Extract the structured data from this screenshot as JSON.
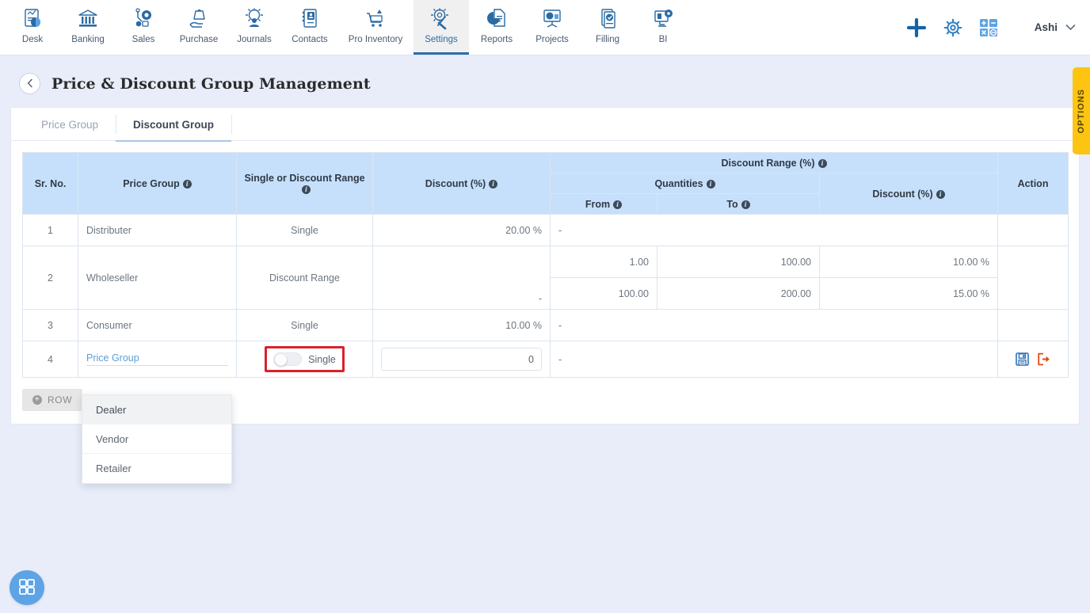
{
  "nav": {
    "items": [
      {
        "label": "Desk",
        "icon": "desk-chart-icon",
        "active": false
      },
      {
        "label": "Banking",
        "icon": "bank-icon",
        "active": false
      },
      {
        "label": "Sales",
        "icon": "sales-icon",
        "active": false
      },
      {
        "label": "Purchase",
        "icon": "purchase-hand-bag-icon",
        "active": false
      },
      {
        "label": "Journals",
        "icon": "journals-gear-people-icon",
        "active": false
      },
      {
        "label": "Contacts",
        "icon": "contacts-card-icon",
        "active": false
      },
      {
        "label": "Pro Inventory",
        "icon": "inventory-cart-icon",
        "active": false
      },
      {
        "label": "Settings",
        "icon": "settings-gear-wrench-icon",
        "active": true
      },
      {
        "label": "Reports",
        "icon": "reports-pie-doc-icon",
        "active": false
      },
      {
        "label": "Projects",
        "icon": "projects-presentation-icon",
        "active": false
      },
      {
        "label": "Filling",
        "icon": "filling-check-doc-icon",
        "active": false
      },
      {
        "label": "BI",
        "icon": "bi-monitor-gear-icon",
        "active": false
      }
    ],
    "right": {
      "add_icon": "plus-icon",
      "settings_icon": "gear-icon",
      "calculator_icon": "calculator-icon",
      "user_name": "Ashi",
      "user_chevron_icon": "chevron-down-icon"
    }
  },
  "options_tab": {
    "label": "OPTIONS"
  },
  "page": {
    "back_icon": "chevron-left-icon",
    "title": "Price & Discount Group Management"
  },
  "tabs": [
    {
      "label": "Price Group",
      "active": false
    },
    {
      "label": "Discount Group",
      "active": true
    }
  ],
  "table": {
    "headers": {
      "sr_no": "Sr. No.",
      "price_group": "Price Group",
      "single_or_range": "Single or Discount Range",
      "discount_pct": "Discount (%)",
      "discount_range_group": "Discount Range (%)",
      "quantities": "Quantities",
      "from": "From",
      "to": "To",
      "range_discount_pct": "Discount (%)",
      "action": "Action"
    },
    "rows": [
      {
        "sr_no": "1",
        "price_group": "Distributer",
        "single_or_range": "Single",
        "discount_pct": "20.00 %",
        "ranges": [],
        "range_placeholder": "-",
        "editing": false
      },
      {
        "sr_no": "2",
        "price_group": "Wholeseller",
        "single_or_range": "Discount Range",
        "discount_pct": "-",
        "ranges": [
          {
            "from": "1.00",
            "to": "100.00",
            "discount": "10.00 %"
          },
          {
            "from": "100.00",
            "to": "200.00",
            "discount": "15.00 %"
          }
        ],
        "range_placeholder": "",
        "editing": false
      },
      {
        "sr_no": "3",
        "price_group": "Consumer",
        "single_or_range": "Single",
        "discount_pct": "10.00 %",
        "ranges": [],
        "range_placeholder": "-",
        "editing": false
      },
      {
        "sr_no": "4",
        "price_group": "Price Group",
        "single_or_range": "Single",
        "toggle_label": "Single",
        "toggle_on": false,
        "discount_value": "0",
        "ranges": [],
        "range_placeholder": "-",
        "editing": true,
        "save_icon": "save-floppy-icon",
        "cancel_icon": "exit-arrow-icon"
      }
    ],
    "add_row_button": {
      "label": "ROW",
      "icon": "plus-circle-icon"
    }
  },
  "dropdown": {
    "options": [
      {
        "label": "Dealer",
        "highlighted": true
      },
      {
        "label": "Vendor",
        "highlighted": false
      },
      {
        "label": "Retailer",
        "highlighted": false
      }
    ]
  },
  "fab": {
    "icon": "grid-apps-icon"
  },
  "colors": {
    "accent": "#2c6ca8",
    "table_header_bg": "#c6e0fb",
    "page_bg": "#e8edf9",
    "highlight_border": "#d8222e",
    "options_tab_bg": "#fdc412",
    "save_icon": "#2f72b5",
    "cancel_icon": "#e04a16",
    "fab_bg": "#5ea3e4"
  }
}
